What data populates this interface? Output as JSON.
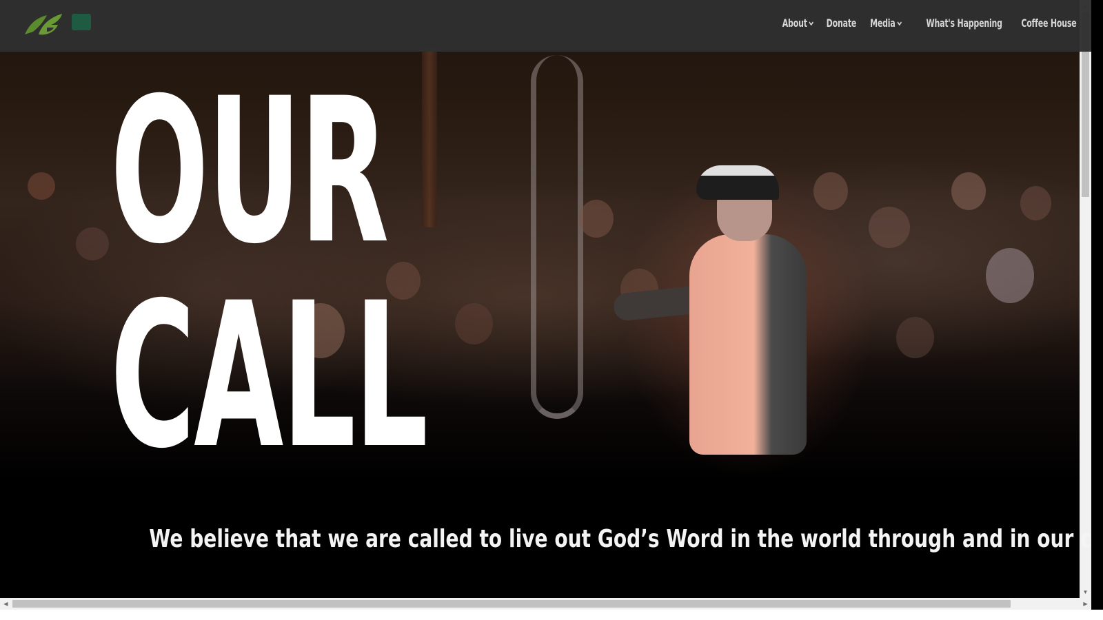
{
  "nav": {
    "items": [
      {
        "label": "About",
        "has_dropdown": true
      },
      {
        "label": "Donate",
        "has_dropdown": false
      },
      {
        "label": "Media",
        "has_dropdown": true
      },
      {
        "label": "What's Happening",
        "has_dropdown": false
      },
      {
        "label": "Coffee House",
        "has_dropdown": false
      }
    ]
  },
  "logo": {
    "icon": "leaf-logo-icon",
    "color": "#5c8b2e"
  },
  "hero": {
    "headline_line1": "OUR",
    "headline_line2": "CALL",
    "tagline": "We believe that we are called to live out God’s Word in the world through and in our community."
  },
  "colors": {
    "navbar_bg": "#303030",
    "nav_text": "#d6d6d6",
    "headline": "#ffffff",
    "page_bg": "#000000"
  }
}
